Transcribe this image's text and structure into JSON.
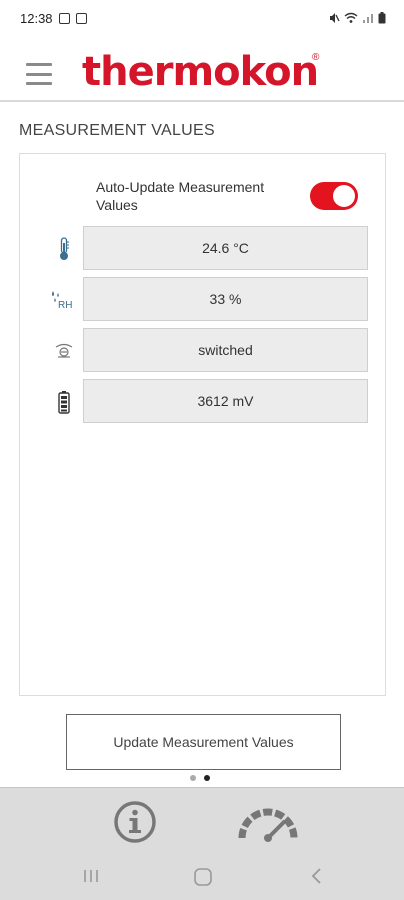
{
  "status_bar": {
    "time": "12:38"
  },
  "header": {
    "logo_text": "thermokon",
    "logo_mark": "®",
    "brand_color": "#d5152a"
  },
  "page": {
    "title": "MEASUREMENT VALUES"
  },
  "auto_update": {
    "label": "Auto-Update Measurement Values",
    "enabled": true,
    "toggle_color": "#e3131f"
  },
  "measurements": [
    {
      "icon": "thermometer-icon",
      "value": "24.6 °C"
    },
    {
      "icon": "humidity-icon",
      "icon_text": "RH",
      "value": "33 %"
    },
    {
      "icon": "contact-switch-icon",
      "value": "switched"
    },
    {
      "icon": "battery-icon",
      "value": "3612 mV"
    }
  ],
  "update_button": {
    "label": "Update Measurement Values"
  },
  "pager": {
    "total": 2,
    "active": 2
  },
  "bottom_nav": {
    "items": [
      "info-icon",
      "gauge-icon"
    ]
  },
  "system_nav": {
    "items": [
      "recent-apps-icon",
      "home-icon",
      "back-icon"
    ]
  }
}
